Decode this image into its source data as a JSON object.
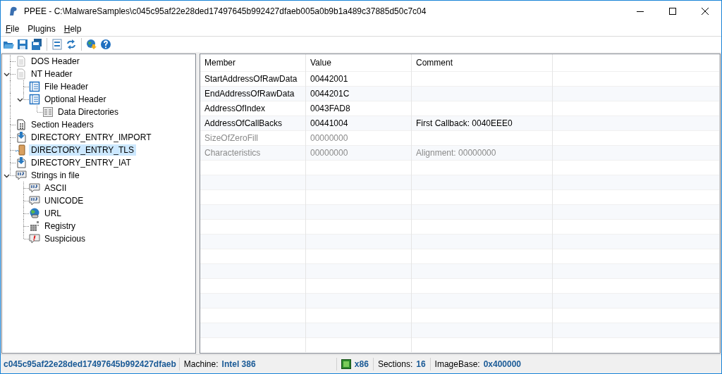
{
  "window": {
    "title": "PPEE - C:\\MalwareSamples\\c045c95af22e28ded17497645b992427dfaeb005a0b9b1a489c37885d50c7c04"
  },
  "menu": [
    {
      "label": "File",
      "mnemonic": true
    },
    {
      "label": "Plugins",
      "mnemonic": false
    },
    {
      "label": "Help",
      "mnemonic": true
    }
  ],
  "tree": [
    {
      "label": "DOS Header",
      "kind": "doc",
      "selected": false
    },
    {
      "label": "NT Header",
      "kind": "doc",
      "selected": false,
      "expanded": true,
      "children": [
        {
          "label": "File Header",
          "kind": "table",
          "selected": false
        },
        {
          "label": "Optional Header",
          "kind": "table",
          "selected": false,
          "expanded": true,
          "children": [
            {
              "label": "Data Directories",
              "kind": "grid",
              "selected": false
            }
          ]
        }
      ]
    },
    {
      "label": "Section Headers",
      "kind": "sections",
      "selected": false
    },
    {
      "label": "DIRECTORY_ENTRY_IMPORT",
      "kind": "import",
      "selected": false
    },
    {
      "label": "DIRECTORY_ENTRY_TLS",
      "kind": "tls",
      "selected": true
    },
    {
      "label": "DIRECTORY_ENTRY_IAT",
      "kind": "import",
      "selected": false
    },
    {
      "label": "Strings in file",
      "kind": "strings",
      "selected": false,
      "expanded": true,
      "children": [
        {
          "label": "ASCII",
          "kind": "strings",
          "selected": false
        },
        {
          "label": "UNICODE",
          "kind": "strings",
          "selected": false
        },
        {
          "label": "URL",
          "kind": "url",
          "selected": false
        },
        {
          "label": "Registry",
          "kind": "registry",
          "selected": false
        },
        {
          "label": "Suspicious",
          "kind": "suspicious",
          "selected": false
        }
      ]
    }
  ],
  "table": {
    "columns": [
      "Member",
      "Value",
      "Comment"
    ],
    "rows": [
      {
        "cells": [
          "StartAddressOfRawData",
          "00442001",
          ""
        ],
        "dimmed": false
      },
      {
        "cells": [
          "EndAddressOfRawData",
          "0044201C",
          ""
        ],
        "dimmed": false
      },
      {
        "cells": [
          "AddressOfIndex",
          "0043FAD8",
          ""
        ],
        "dimmed": false
      },
      {
        "cells": [
          "AddressOfCallBacks",
          "00441004",
          "First Callback: 0040EEE0"
        ],
        "dimmed": false
      },
      {
        "cells": [
          "SizeOfZeroFill",
          "00000000",
          ""
        ],
        "dimmed": true
      },
      {
        "cells": [
          "Characteristics",
          "00000000",
          "Alignment: 00000000"
        ],
        "dimmed": true
      }
    ]
  },
  "status_bar": [
    {
      "kind": "hash",
      "value": "c045c95af22e28ded17497645b992427dfaeb"
    },
    {
      "kind": "field",
      "label": "Machine:",
      "value": "Intel 386"
    },
    {
      "kind": "chip",
      "value": "x86"
    },
    {
      "kind": "field",
      "label": "Sections:",
      "value": "16"
    },
    {
      "kind": "field",
      "label": "ImageBase:",
      "value": "0x400000"
    }
  ]
}
